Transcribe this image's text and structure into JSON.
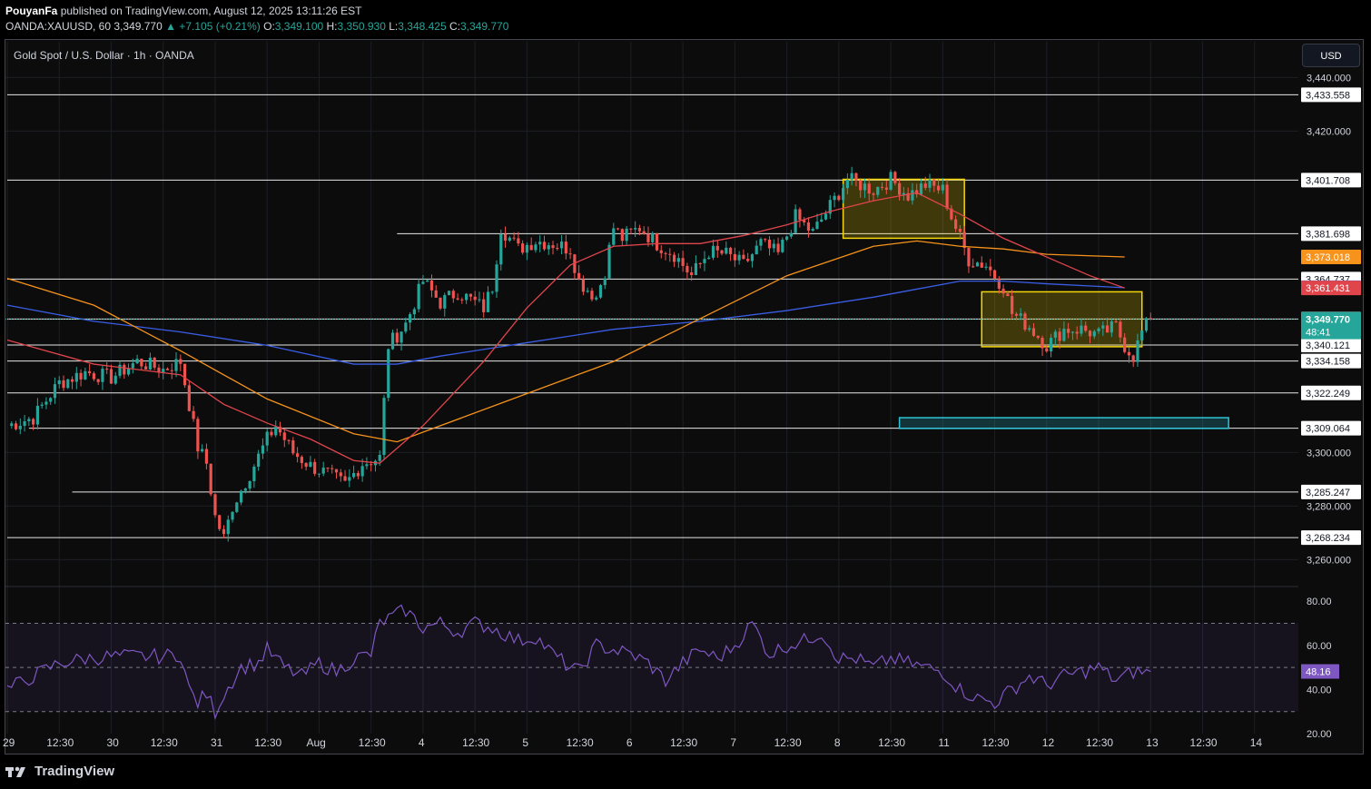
{
  "header": {
    "publisher": "PouyanFa",
    "published_text": "published on TradingView.com, August 12, 2025 13:11:26 EST",
    "symbol": "OANDA:XAUUSD, 60",
    "last": "3,349.770",
    "change": "+7.105 (+0.21%)",
    "o_label": "O:",
    "o": "3,349.100",
    "h_label": "H:",
    "h": "3,350.930",
    "l_label": "L:",
    "l": "3,348.425",
    "c_label": "C:",
    "c": "3,349.770"
  },
  "chart_title": "Gold Spot / U.S. Dollar · 1h · OANDA",
  "currency_button": "USD",
  "footer": {
    "brand": "TradingView"
  },
  "colors": {
    "up": "#26a69a",
    "down": "#ef5350",
    "ema_fast": "#e0454c",
    "ema_mid": "#f7931a",
    "ema_slow": "#3a5ee6",
    "rsi": "#7e57c2",
    "zone": "#f5d60a",
    "target": "#2ec4d6"
  },
  "chart_data": [
    {
      "type": "candlestick",
      "title": "Gold Spot / U.S. Dollar · 1h · OANDA",
      "ylim": [
        3252,
        3452
      ],
      "y_ticks": [
        "3,440.000",
        "3,420.000",
        "3,300.000",
        "3,280.000",
        "3,260.000"
      ],
      "y_tick_values": [
        3440,
        3420,
        3300,
        3280,
        3260
      ],
      "x_ticks": [
        "29",
        "12:30",
        "30",
        "12:30",
        "31",
        "12:30",
        "Aug",
        "12:30",
        "4",
        "12:30",
        "5",
        "12:30",
        "6",
        "12:30",
        "7",
        "12:30",
        "8",
        "12:30",
        "11",
        "12:30",
        "12",
        "12:30",
        "13",
        "12:30",
        "14"
      ],
      "x_tick_index": [
        0,
        12,
        24,
        36,
        48,
        60,
        72,
        84,
        96,
        108,
        120,
        132,
        144,
        156,
        168,
        180,
        192,
        204,
        216,
        228,
        240,
        252,
        264,
        276,
        288
      ],
      "horizontal_levels": [
        {
          "label": "3,433.558",
          "value": 3433.558
        },
        {
          "label": "3,401.708",
          "value": 3401.708
        },
        {
          "label": "3,381.698",
          "value": 3381.698
        },
        {
          "label": "3,364.737",
          "value": 3364.737
        },
        {
          "label": "3,349.831",
          "value": 3349.831
        },
        {
          "label": "3,340.121",
          "value": 3340.121
        },
        {
          "label": "3,334.158",
          "value": 3334.158
        },
        {
          "label": "3,322.249",
          "value": 3322.249
        },
        {
          "label": "3,309.064",
          "value": 3309.064
        },
        {
          "label": "3,285.247",
          "value": 3285.247
        },
        {
          "label": "3,268.234",
          "value": 3268.234
        }
      ],
      "price_tags": [
        {
          "label": "3,373.018",
          "value": 3373.018,
          "color": "#f7931a"
        },
        {
          "label": "3,361.535",
          "value": 3361.535,
          "color": "#3a5ee6"
        },
        {
          "label": "3,361.431",
          "value": 3361.431,
          "color": "#e0454c"
        }
      ],
      "last_price": {
        "label": "3,349.770",
        "countdown": "48:41",
        "value": 3349.77
      },
      "series_points": [
        [
          0,
          3310
        ],
        [
          6,
          3313
        ],
        [
          12,
          3326
        ],
        [
          18,
          3330
        ],
        [
          24,
          3328
        ],
        [
          30,
          3334
        ],
        [
          36,
          3331
        ],
        [
          40,
          3334
        ],
        [
          42,
          3318
        ],
        [
          44,
          3302
        ],
        [
          46,
          3296
        ],
        [
          48,
          3276
        ],
        [
          50,
          3268
        ],
        [
          52,
          3280
        ],
        [
          56,
          3292
        ],
        [
          60,
          3305
        ],
        [
          62,
          3310
        ],
        [
          66,
          3300
        ],
        [
          70,
          3295
        ],
        [
          74,
          3292
        ],
        [
          78,
          3288
        ],
        [
          82,
          3296
        ],
        [
          86,
          3298
        ],
        [
          88,
          3340
        ],
        [
          90,
          3344
        ],
        [
          92,
          3348
        ],
        [
          96,
          3364
        ],
        [
          100,
          3356
        ],
        [
          104,
          3360
        ],
        [
          110,
          3354
        ],
        [
          112,
          3362
        ],
        [
          114,
          3384
        ],
        [
          118,
          3376
        ],
        [
          122,
          3379
        ],
        [
          126,
          3378
        ],
        [
          130,
          3376
        ],
        [
          132,
          3364
        ],
        [
          136,
          3358
        ],
        [
          138,
          3368
        ],
        [
          140,
          3384
        ],
        [
          142,
          3380
        ],
        [
          146,
          3384
        ],
        [
          150,
          3378
        ],
        [
          154,
          3374
        ],
        [
          158,
          3366
        ],
        [
          162,
          3375
        ],
        [
          166,
          3374
        ],
        [
          170,
          3370
        ],
        [
          174,
          3378
        ],
        [
          178,
          3374
        ],
        [
          182,
          3388
        ],
        [
          186,
          3382
        ],
        [
          190,
          3392
        ],
        [
          194,
          3402
        ],
        [
          200,
          3398
        ],
        [
          204,
          3402
        ],
        [
          208,
          3396
        ],
        [
          212,
          3400
        ],
        [
          216,
          3398
        ],
        [
          218,
          3388
        ],
        [
          222,
          3372
        ],
        [
          226,
          3370
        ],
        [
          230,
          3362
        ],
        [
          232,
          3352
        ],
        [
          236,
          3347
        ],
        [
          240,
          3340
        ],
        [
          244,
          3346
        ],
        [
          248,
          3346
        ],
        [
          252,
          3344
        ],
        [
          256,
          3347
        ],
        [
          258,
          3340
        ],
        [
          260,
          3336
        ],
        [
          262,
          3345
        ],
        [
          264,
          3349.77
        ]
      ],
      "ema_fast_points": [
        [
          0,
          3342
        ],
        [
          20,
          3333
        ],
        [
          40,
          3329
        ],
        [
          50,
          3318
        ],
        [
          60,
          3311
        ],
        [
          70,
          3305
        ],
        [
          80,
          3297
        ],
        [
          86,
          3296
        ],
        [
          96,
          3310
        ],
        [
          110,
          3334
        ],
        [
          120,
          3354
        ],
        [
          130,
          3370
        ],
        [
          140,
          3377
        ],
        [
          150,
          3378
        ],
        [
          160,
          3378
        ],
        [
          170,
          3381
        ],
        [
          180,
          3385
        ],
        [
          190,
          3390
        ],
        [
          200,
          3394
        ],
        [
          210,
          3397
        ],
        [
          220,
          3389
        ],
        [
          230,
          3380
        ],
        [
          240,
          3373
        ],
        [
          250,
          3366
        ],
        [
          258,
          3361.431
        ]
      ],
      "ema_mid_points": [
        [
          0,
          3365
        ],
        [
          20,
          3355
        ],
        [
          40,
          3338
        ],
        [
          60,
          3320
        ],
        [
          80,
          3307
        ],
        [
          90,
          3304
        ],
        [
          100,
          3310
        ],
        [
          120,
          3322
        ],
        [
          140,
          3334
        ],
        [
          160,
          3350
        ],
        [
          180,
          3366
        ],
        [
          200,
          3377
        ],
        [
          210,
          3379
        ],
        [
          220,
          3377
        ],
        [
          230,
          3376
        ],
        [
          240,
          3374
        ],
        [
          258,
          3373.018
        ]
      ],
      "ema_slow_points": [
        [
          0,
          3355
        ],
        [
          20,
          3349
        ],
        [
          40,
          3345
        ],
        [
          60,
          3340
        ],
        [
          80,
          3333
        ],
        [
          90,
          3333
        ],
        [
          100,
          3336
        ],
        [
          120,
          3341
        ],
        [
          140,
          3346
        ],
        [
          160,
          3349
        ],
        [
          180,
          3353
        ],
        [
          200,
          3358
        ],
        [
          210,
          3361
        ],
        [
          220,
          3364
        ],
        [
          230,
          3364
        ],
        [
          240,
          3363
        ],
        [
          258,
          3361.535
        ]
      ],
      "zones": [
        {
          "x0": 193,
          "x1": 221,
          "y0": 3380,
          "y1": 3402,
          "color": "#f5d60a"
        },
        {
          "x0": 225,
          "x1": 262,
          "y0": 3339.5,
          "y1": 3360,
          "color": "#f5d60a"
        },
        {
          "x0": 206,
          "x1": 282,
          "y0": 3309,
          "y1": 3313,
          "color": "#2ec4d6"
        }
      ]
    },
    {
      "type": "line",
      "series_name": "",
      "ylim": [
        20,
        85
      ],
      "y_ticks": [
        "80.00",
        "60.00",
        "40.00",
        "20.00"
      ],
      "y_tick_values": [
        80,
        60,
        40,
        20
      ],
      "band": [
        30,
        70
      ],
      "midline": 50,
      "last_value": {
        "label": "48.16",
        "value": 48.16
      },
      "values_points": [
        [
          0,
          40
        ],
        [
          6,
          46
        ],
        [
          12,
          52
        ],
        [
          18,
          54
        ],
        [
          24,
          55
        ],
        [
          30,
          55
        ],
        [
          36,
          55
        ],
        [
          40,
          56
        ],
        [
          42,
          40
        ],
        [
          44,
          34
        ],
        [
          46,
          38
        ],
        [
          48,
          30
        ],
        [
          50,
          38
        ],
        [
          54,
          50
        ],
        [
          58,
          52
        ],
        [
          60,
          58
        ],
        [
          64,
          50
        ],
        [
          68,
          46
        ],
        [
          72,
          52
        ],
        [
          76,
          48
        ],
        [
          80,
          54
        ],
        [
          84,
          56
        ],
        [
          86,
          70
        ],
        [
          88,
          72
        ],
        [
          90,
          74
        ],
        [
          92,
          76
        ],
        [
          96,
          68
        ],
        [
          100,
          70
        ],
        [
          104,
          66
        ],
        [
          108,
          70
        ],
        [
          112,
          68
        ],
        [
          114,
          66
        ],
        [
          118,
          62
        ],
        [
          122,
          64
        ],
        [
          126,
          56
        ],
        [
          130,
          50
        ],
        [
          132,
          48
        ],
        [
          136,
          60
        ],
        [
          140,
          58
        ],
        [
          144,
          56
        ],
        [
          148,
          52
        ],
        [
          152,
          44
        ],
        [
          156,
          52
        ],
        [
          160,
          58
        ],
        [
          164,
          54
        ],
        [
          168,
          60
        ],
        [
          172,
          70
        ],
        [
          176,
          56
        ],
        [
          180,
          60
        ],
        [
          184,
          62
        ],
        [
          188,
          66
        ],
        [
          192,
          54
        ],
        [
          196,
          54
        ],
        [
          200,
          50
        ],
        [
          204,
          54
        ],
        [
          208,
          52
        ],
        [
          212,
          50
        ],
        [
          216,
          48
        ],
        [
          220,
          40
        ],
        [
          224,
          36
        ],
        [
          228,
          34
        ],
        [
          232,
          40
        ],
        [
          236,
          46
        ],
        [
          240,
          42
        ],
        [
          244,
          46
        ],
        [
          248,
          48
        ],
        [
          252,
          50
        ],
        [
          256,
          44
        ],
        [
          260,
          48
        ],
        [
          264,
          48.16
        ]
      ]
    }
  ]
}
